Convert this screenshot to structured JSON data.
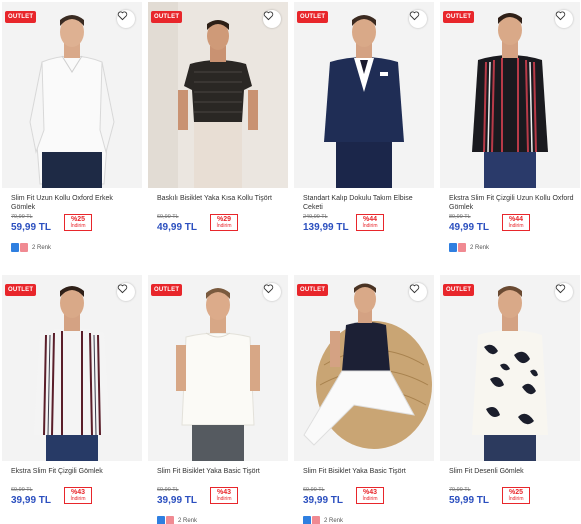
{
  "favorite_icon": "heart-outline-icon",
  "badge_color": "#e8262b",
  "price_color": "#2b4fbf",
  "products": [
    {
      "title": "Slim Fit Uzun Kollu Oxford Erkek Gömlek",
      "outlet": "OUTLET",
      "old_price": "79,99 TL",
      "price": "59,99 TL",
      "discount": "%25",
      "discount_label": "İndirim",
      "colors": "2 Renk"
    },
    {
      "title": "Baskılı Bisiklet Yaka Kısa Kollu Tişört",
      "outlet": "OUTLET",
      "old_price": "69,99 TL",
      "price": "49,99 TL",
      "discount": "%29",
      "discount_label": "İndirim",
      "colors": ""
    },
    {
      "title": "Standart Kalıp Dokulu Takım Elbise Ceketi",
      "outlet": "OUTLET",
      "old_price": "249,99 TL",
      "price": "139,99 TL",
      "discount": "%44",
      "discount_label": "İndirim",
      "colors": ""
    },
    {
      "title": "Ekstra Slim Fit Çizgili Uzun Kollu Oxford Gömlek",
      "outlet": "OUTLET",
      "old_price": "89,99 TL",
      "price": "49,99 TL",
      "discount": "%44",
      "discount_label": "İndirim",
      "colors": "2 Renk"
    },
    {
      "title": "Ekstra Slim Fit Çizgili Gömlek",
      "outlet": "OUTLET",
      "old_price": "69,99 TL",
      "price": "39,99 TL",
      "discount": "%43",
      "discount_label": "İndirim",
      "colors": ""
    },
    {
      "title": "Slim Fit Bisiklet Yaka Basic Tişört",
      "outlet": "OUTLET",
      "old_price": "69,99 TL",
      "price": "39,99 TL",
      "discount": "%43",
      "discount_label": "İndirim",
      "colors": "2 Renk"
    },
    {
      "title": "Slim Fit Bisiklet Yaka Basic Tişört",
      "outlet": "OUTLET",
      "old_price": "69,99 TL",
      "price": "39,99 TL",
      "discount": "%43",
      "discount_label": "İndirim",
      "colors": "2 Renk"
    },
    {
      "title": "Slim Fit Desenli Gömlek",
      "outlet": "OUTLET",
      "old_price": "79,99 TL",
      "price": "59,99 TL",
      "discount": "%25",
      "discount_label": "İndirim",
      "colors": ""
    }
  ]
}
